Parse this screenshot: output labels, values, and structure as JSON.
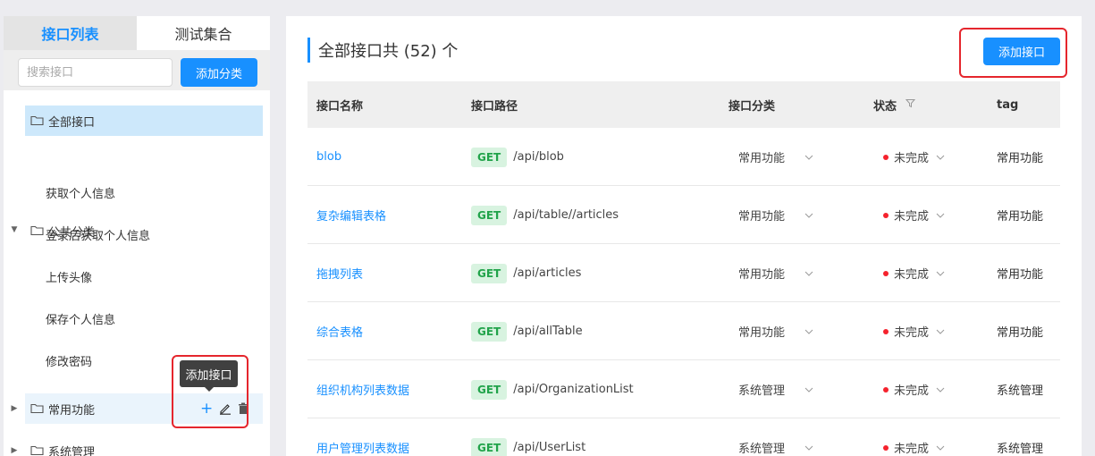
{
  "sidebar": {
    "tabs": [
      {
        "label": "接口列表",
        "active": true
      },
      {
        "label": "测试集合",
        "active": false
      }
    ],
    "search": {
      "placeholder": "搜索接口",
      "value": ""
    },
    "add_category_label": "添加分类",
    "tree": {
      "all_label": "全部接口",
      "groups": [
        {
          "label": "公共分类",
          "expanded": true,
          "children": [
            "获取个人信息",
            "登录后获取个人信息",
            "上传头像",
            "保存个人信息",
            "修改密码"
          ]
        },
        {
          "label": "常用功能",
          "expanded": false
        },
        {
          "label": "系统管理",
          "expanded": false
        }
      ]
    },
    "tooltip": "添加接口",
    "node_action_icons": [
      "plus-icon",
      "edit-icon",
      "trash-icon"
    ]
  },
  "main": {
    "title": "全部接口共 (52) 个",
    "add_api_label": "添加接口",
    "columns": {
      "name": "接口名称",
      "path": "接口路径",
      "category": "接口分类",
      "status": "状态",
      "tag": "tag"
    },
    "rows": [
      {
        "name": "blob",
        "method": "GET",
        "path": "/api/blob",
        "category": "常用功能",
        "status": "未完成",
        "tag": "常用功能"
      },
      {
        "name": "复杂编辑表格",
        "method": "GET",
        "path": "/api/table//articles",
        "category": "常用功能",
        "status": "未完成",
        "tag": "常用功能"
      },
      {
        "name": "拖拽列表",
        "method": "GET",
        "path": "/api/articles",
        "category": "常用功能",
        "status": "未完成",
        "tag": "常用功能"
      },
      {
        "name": "综合表格",
        "method": "GET",
        "path": "/api/allTable",
        "category": "常用功能",
        "status": "未完成",
        "tag": "常用功能"
      },
      {
        "name": "组织机构列表数据",
        "method": "GET",
        "path": "/api/OrganizationList",
        "category": "系统管理",
        "status": "未完成",
        "tag": "系统管理"
      },
      {
        "name": "用户管理列表数据",
        "method": "GET",
        "path": "/api/UserList",
        "category": "系统管理",
        "status": "未完成",
        "tag": "系统管理"
      }
    ]
  },
  "colors": {
    "accent": "#1890ff",
    "status_incomplete": "#f5222d",
    "get_tag_bg": "#d8f3e0",
    "get_tag_text": "#21a34a",
    "highlight": "#e5262d"
  }
}
